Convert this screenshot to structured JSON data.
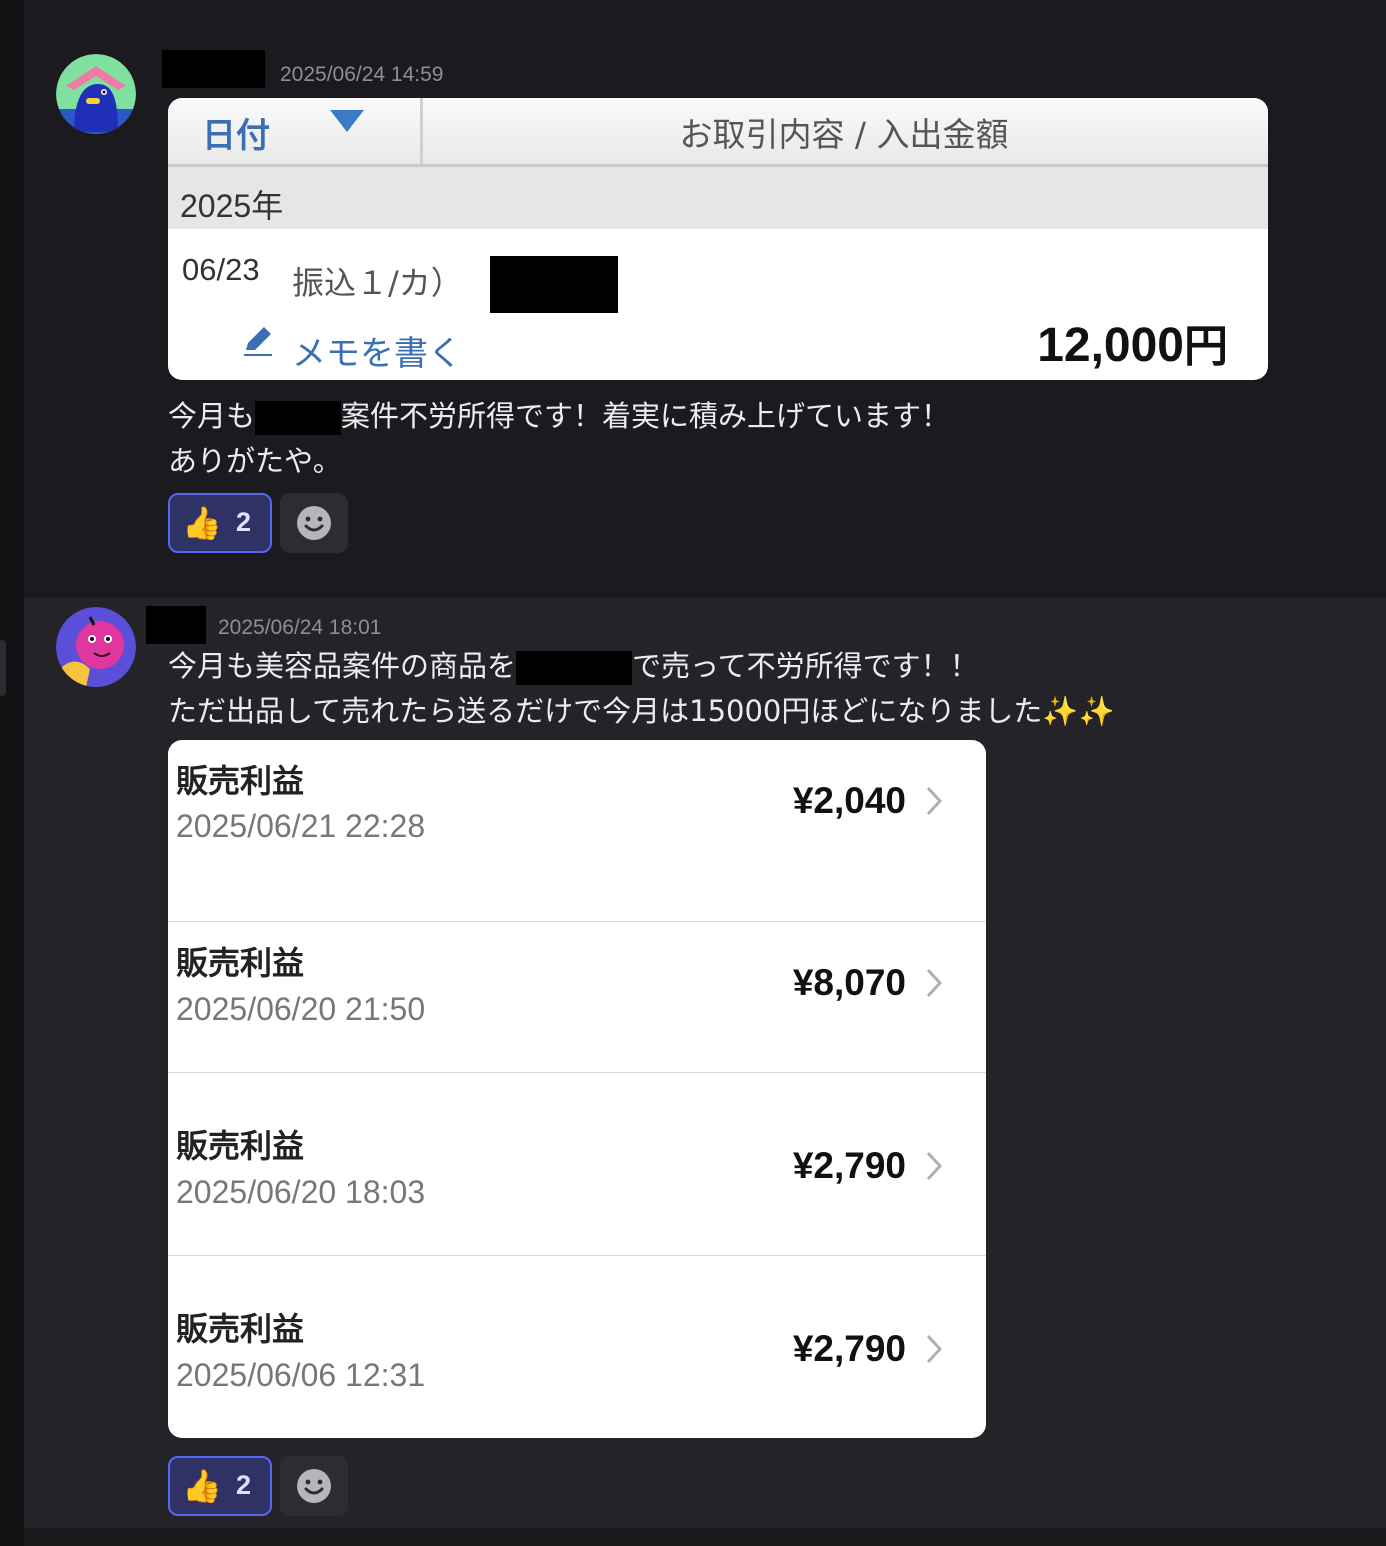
{
  "messages": [
    {
      "timestamp": "2025/06/24 14:59",
      "bank": {
        "date_header": "日付",
        "content_header": "お取引内容 / 入出金額",
        "year": "2025年",
        "entry_date": "06/23",
        "entry_desc": "振込１/カ）",
        "memo": "メモを書く",
        "amount": "12,000",
        "currency": "円"
      },
      "text_line1_a": "今月も",
      "text_line1_b": "案件不労所得です！着実に積み上げています！",
      "text_line2": "ありがたや。",
      "reaction": {
        "emoji": "👍",
        "count": "2"
      }
    },
    {
      "timestamp": "2025/06/24 18:01",
      "text_line1_a": "今月も美容品案件の商品を",
      "text_line1_b": "で売って不労所得です！！",
      "text_line2": "ただ出品して売れたら送るだけで今月は15000円ほどになりました✨✨",
      "sales": [
        {
          "title": "販売利益",
          "date": "2025/06/21 22:28",
          "amount": "¥2,040"
        },
        {
          "title": "販売利益",
          "date": "2025/06/20 21:50",
          "amount": "¥8,070"
        },
        {
          "title": "販売利益",
          "date": "2025/06/20 18:03",
          "amount": "¥2,790"
        },
        {
          "title": "販売利益",
          "date": "2025/06/06 12:31",
          "amount": "¥2,790"
        }
      ],
      "reaction": {
        "emoji": "👍",
        "count": "2"
      }
    }
  ]
}
